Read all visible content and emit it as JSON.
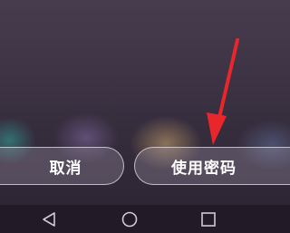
{
  "lockscreen": {
    "cancel_label": "取消",
    "use_password_label": "使用密码"
  },
  "annotation": {
    "arrow_color": "#e8262b"
  },
  "navbar": {
    "back_icon": "back-triangle-icon",
    "home_icon": "home-circle-icon",
    "recent_icon": "recent-apps-square-icon"
  }
}
